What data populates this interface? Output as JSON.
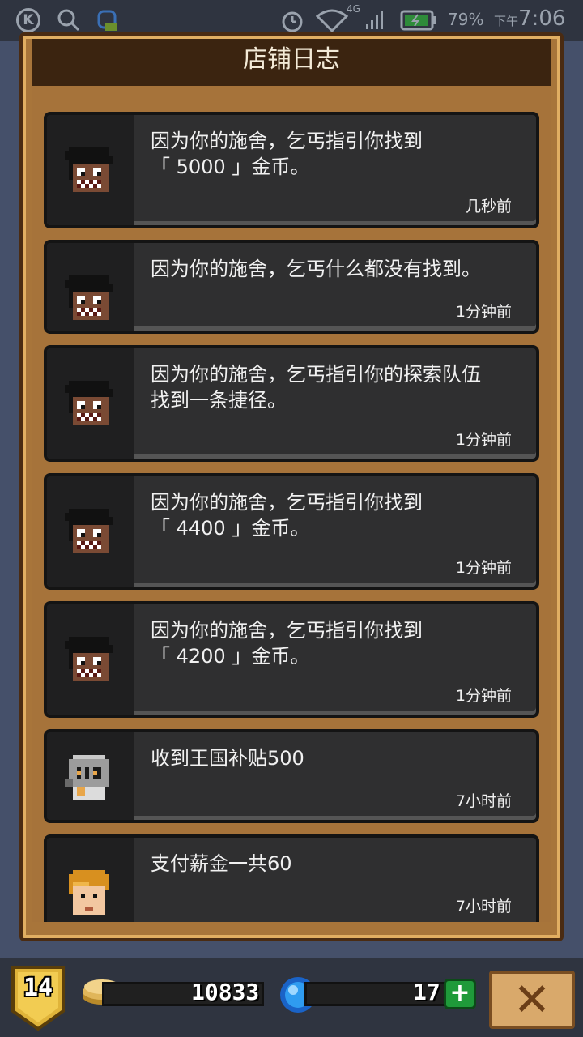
{
  "status_bar": {
    "battery_percent": "79%",
    "time_period": "下午",
    "time": "7:06",
    "network": "4G"
  },
  "panel": {
    "title": "店铺日志"
  },
  "log_entries": [
    {
      "avatar": "beggar",
      "message_line1": "因为你的施舍，乞丐指引你找到",
      "message_line2": "「 5000 」金币。",
      "time": "几秒前"
    },
    {
      "avatar": "beggar",
      "message_line1": "因为你的施舍，乞丐什么都没有找到。",
      "message_line2": "",
      "time": "1分钟前"
    },
    {
      "avatar": "beggar",
      "message_line1": "因为你的施舍，乞丐指引你的探索队伍",
      "message_line2": "找到一条捷径。",
      "time": "1分钟前"
    },
    {
      "avatar": "beggar",
      "message_line1": "因为你的施舍，乞丐指引你找到",
      "message_line2": "「 4400 」金币。",
      "time": "1分钟前"
    },
    {
      "avatar": "beggar",
      "message_line1": "因为你的施舍，乞丐指引你找到",
      "message_line2": "「 4200 」金币。",
      "time": "1分钟前"
    },
    {
      "avatar": "knight",
      "message_line1": "收到王国补贴500",
      "message_line2": "",
      "time": "7小时前"
    },
    {
      "avatar": "blonde-worker",
      "message_line1": "支付薪金一共60",
      "message_line2": "",
      "time": "7小时前"
    }
  ],
  "bottom_bar": {
    "level": "14",
    "gold": "10833",
    "gems": "17",
    "plus_label": "+",
    "close_label": "✕"
  },
  "colors": {
    "frame": "#a8753a",
    "header": "#3b2410",
    "card": "#2f2f30",
    "plus": "#1f9a3a"
  }
}
